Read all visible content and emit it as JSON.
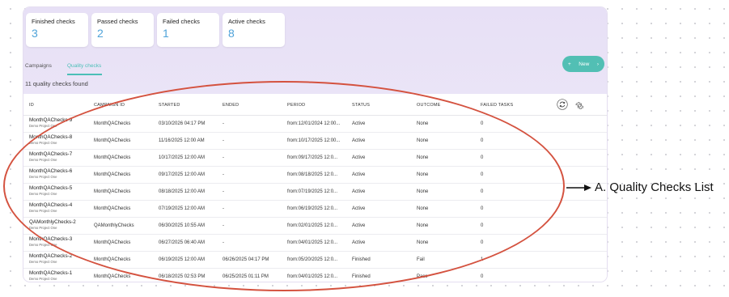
{
  "summary_cards": [
    {
      "title": "Finished checks",
      "value": "3"
    },
    {
      "title": "Passed checks",
      "value": "2"
    },
    {
      "title": "Failed checks",
      "value": "1"
    },
    {
      "title": "Active checks",
      "value": "8"
    }
  ],
  "tabs": [
    {
      "label": "Campaigns",
      "active": false
    },
    {
      "label": "Quality checks",
      "active": true
    }
  ],
  "new_button": {
    "label": "New",
    "plus": "+",
    "chevron": "›"
  },
  "count_text": "11 quality checks found",
  "table": {
    "columns": [
      "ID",
      "CAMPAIGN ID",
      "STARTED",
      "ENDED",
      "PERIOD",
      "STATUS",
      "OUTCOME",
      "FAILED TASKS"
    ],
    "rows": [
      {
        "id": "MonthQAChecks-9",
        "project": "Demo Project One",
        "campaign": "MonthQAChecks",
        "started": "03/10/2026 04:17 PM",
        "ended": "-",
        "period": "from:12/01/2024 12:00...",
        "status": "Active",
        "outcome": "None",
        "failed": "0"
      },
      {
        "id": "MonthQAChecks-8",
        "project": "Demo Project One",
        "campaign": "MonthQAChecks",
        "started": "11/16/2025 12:00 AM",
        "ended": "-",
        "period": "from:10/17/2025 12:00...",
        "status": "Active",
        "outcome": "None",
        "failed": "0"
      },
      {
        "id": "MonthQAChecks-7",
        "project": "Demo Project One",
        "campaign": "MonthQAChecks",
        "started": "10/17/2025 12:00 AM",
        "ended": "-",
        "period": "from:09/17/2025 12:0...",
        "status": "Active",
        "outcome": "None",
        "failed": "0"
      },
      {
        "id": "MonthQAChecks-6",
        "project": "Demo Project One",
        "campaign": "MonthQAChecks",
        "started": "09/17/2025 12:00 AM",
        "ended": "-",
        "period": "from:08/18/2025 12:0...",
        "status": "Active",
        "outcome": "None",
        "failed": "0"
      },
      {
        "id": "MonthQAChecks-5",
        "project": "Demo Project One",
        "campaign": "MonthQAChecks",
        "started": "08/18/2025 12:00 AM",
        "ended": "-",
        "period": "from:07/19/2025 12:0...",
        "status": "Active",
        "outcome": "None",
        "failed": "0"
      },
      {
        "id": "MonthQAChecks-4",
        "project": "Demo Project One",
        "campaign": "MonthQAChecks",
        "started": "07/19/2025 12:00 AM",
        "ended": "-",
        "period": "from:06/19/2025 12:0...",
        "status": "Active",
        "outcome": "None",
        "failed": "0"
      },
      {
        "id": "QAMonthlyChecks-2",
        "project": "Demo Project One",
        "campaign": "QAMonthlyChecks",
        "started": "06/30/2025 10:55 AM",
        "ended": "-",
        "period": "from:02/01/2025 12:0...",
        "status": "Active",
        "outcome": "None",
        "failed": "0"
      },
      {
        "id": "MonthQAChecks-3",
        "project": "Demo Project One",
        "campaign": "MonthQAChecks",
        "started": "06/27/2025 06:40 AM",
        "ended": "-",
        "period": "from:04/01/2025 12:0...",
        "status": "Active",
        "outcome": "None",
        "failed": "0"
      },
      {
        "id": "MonthQAChecks-2",
        "project": "Demo Project One",
        "campaign": "MonthQAChecks",
        "started": "06/19/2025 12:00 AM",
        "ended": "06/26/2025 04:17 PM",
        "period": "from:05/20/2025 12:0...",
        "status": "Finished",
        "outcome": "Fail",
        "failed": "1"
      },
      {
        "id": "MonthQAChecks-1",
        "project": "Demo Project One",
        "campaign": "MonthQAChecks",
        "started": "06/18/2025 02:53 PM",
        "ended": "06/25/2025 01:11 PM",
        "period": "from:04/01/2025 12:0...",
        "status": "Finished",
        "outcome": "Pass",
        "failed": "0"
      }
    ]
  },
  "annotation": {
    "label": "A. Quality Checks List",
    "color": "#d4523f"
  },
  "colors": {
    "accent": "#52bfb4",
    "card_value": "#4fa3d9",
    "panel_bg": "#e7e0f6"
  },
  "icons": [
    "refresh-icon",
    "gear-icon",
    "plus-icon",
    "chevron-right-icon",
    "arrow-right-icon"
  ]
}
